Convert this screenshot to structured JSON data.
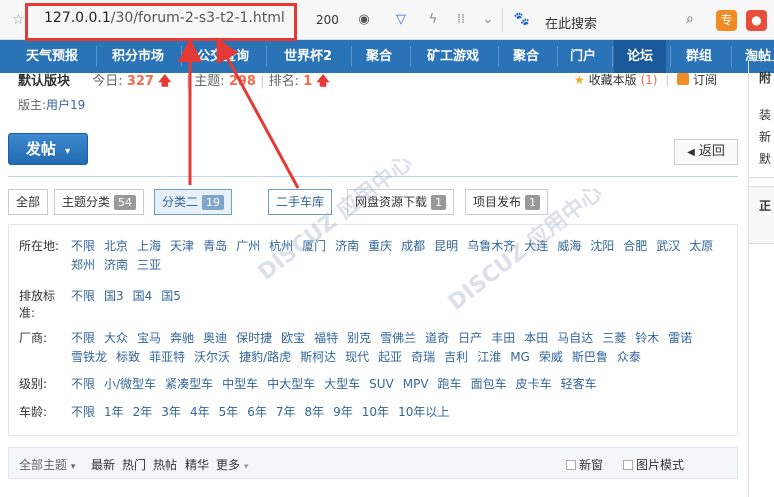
{
  "address_bar": {
    "url_host": "127.0.0.1",
    "url_path": "/30/forum-2-s3-t2-1.html",
    "status_code": "200",
    "search_placeholder": "在此搜索",
    "ext1_label": "专",
    "ext2_label": "●"
  },
  "nav": {
    "items": [
      "天气预报",
      "积分市场",
      "公交查询",
      "世界杯2",
      "聚合",
      "矿工游戏",
      "聚合",
      "门户",
      "论坛",
      "群组",
      "淘帖"
    ],
    "active_index": 8
  },
  "forum": {
    "name": "默认版块",
    "today_label": "今日:",
    "today_count": "327",
    "topics_label": "主题:",
    "topics_count": "298",
    "rank_label": "排名:",
    "rank_value": "1",
    "moderator_label": "版主:",
    "moderator": "用户19",
    "favorite_label": "收藏本版",
    "favorite_count": "(1)",
    "subscribe_label": "订阅"
  },
  "sidebar": {
    "lines": [
      "附",
      "装",
      "新",
      "默"
    ],
    "box2_title": "正"
  },
  "post_button": "发帖",
  "back_button": "返回",
  "tabs": [
    {
      "label": "全部",
      "badge": ""
    },
    {
      "label": "主题分类",
      "badge": "54"
    },
    {
      "label": "分类二",
      "badge": "19"
    },
    {
      "label": "二手车库",
      "badge": ""
    },
    {
      "label": "网盘资源下载",
      "badge": "1"
    },
    {
      "label": "项目发布",
      "badge": "1"
    }
  ],
  "filters": [
    {
      "label": "所在地:",
      "options": [
        "不限",
        "北京",
        "上海",
        "天津",
        "青岛",
        "广州",
        "杭州",
        "厦门",
        "济南",
        "重庆",
        "成都",
        "昆明",
        "乌鲁木齐",
        "大连",
        "威海",
        "沈阳",
        "合肥",
        "武汉",
        "太原",
        "郑州",
        "济南",
        "三亚"
      ]
    },
    {
      "label": "排放标准:",
      "options": [
        "不限",
        "国3",
        "国4",
        "国5"
      ]
    },
    {
      "label": "厂商:",
      "options": [
        "不限",
        "大众",
        "宝马",
        "奔驰",
        "奥迪",
        "保时捷",
        "欧宝",
        "福特",
        "别克",
        "雪佛兰",
        "道奇",
        "日产",
        "丰田",
        "本田",
        "马自达",
        "三菱",
        "铃木",
        "雷诺",
        "雪铁龙",
        "标致",
        "菲亚特",
        "沃尔沃",
        "捷豹/路虎",
        "斯柯达",
        "现代",
        "起亚",
        "奇瑞",
        "吉利",
        "江淮",
        "MG",
        "荣威",
        "斯巴鲁",
        "众泰"
      ]
    },
    {
      "label": "级别:",
      "options": [
        "不限",
        "小/微型车",
        "紧凑型车",
        "中型车",
        "中大型车",
        "大型车",
        "SUV",
        "MPV",
        "跑车",
        "面包车",
        "皮卡车",
        "轻客车"
      ]
    },
    {
      "label": "车龄:",
      "options": [
        "不限",
        "1年",
        "2年",
        "3年",
        "4年",
        "5年",
        "6年",
        "7年",
        "8年",
        "9年",
        "10年",
        "10年以上"
      ]
    }
  ],
  "listbar": {
    "all_topics": "全部主题",
    "latest": "最新",
    "hot": "热门",
    "hot_posts": "热帖",
    "digest": "精华",
    "more": "更多",
    "new_window": "新窗",
    "image_mode": "图片模式"
  }
}
